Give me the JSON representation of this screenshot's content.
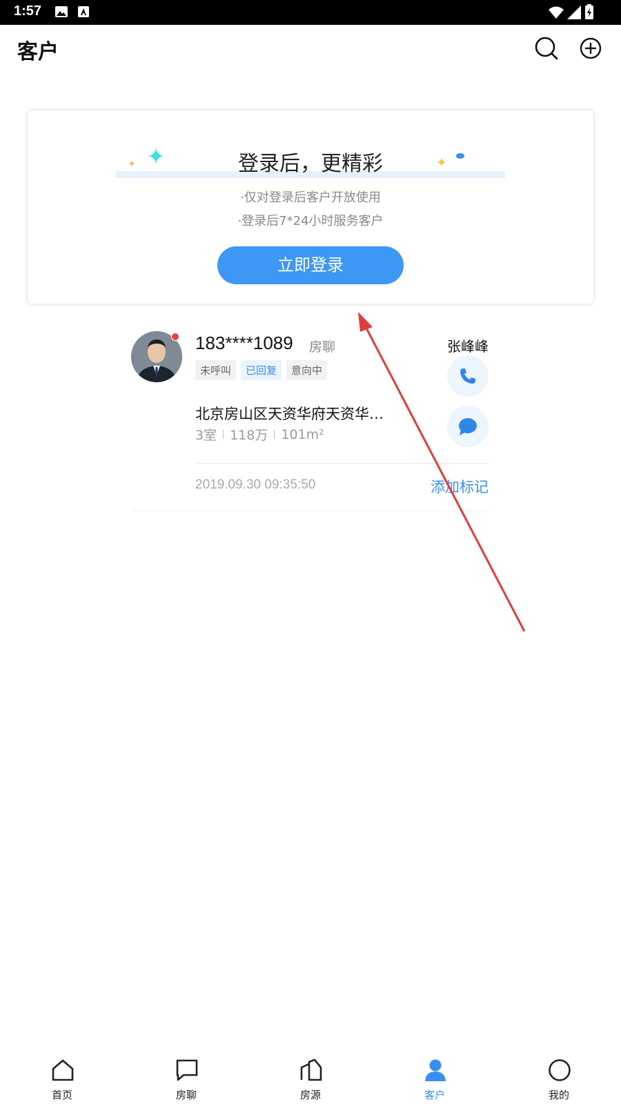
{
  "status_bar": {
    "time": "1:57"
  },
  "header": {
    "title": "客户"
  },
  "login_card": {
    "title": "登录后，更精彩",
    "notes": [
      "·仅对登录后客户开放使用",
      "·登录后7*24小时服务客户"
    ],
    "button_label": "立即登录"
  },
  "customer": {
    "phone": "183****1089",
    "source": "房聊",
    "agent_name": "张峰峰",
    "tags": [
      "未呼叫",
      "已回复",
      "意向中"
    ],
    "address": "北京房山区天资华府天资华…",
    "specs": {
      "rooms": "3室",
      "price": "118万",
      "area": "101m²"
    },
    "datetime": "2019.09.30 09:35:50",
    "add_mark_label": "添加标记"
  },
  "tabbar": {
    "tabs": [
      {
        "label": "首页",
        "icon": "home-icon"
      },
      {
        "label": "房聊",
        "icon": "chat-icon"
      },
      {
        "label": "房源",
        "icon": "building-icon"
      },
      {
        "label": "客户",
        "icon": "user-icon",
        "active": true
      },
      {
        "label": "我的",
        "icon": "profile-circle-icon"
      }
    ]
  },
  "colors": {
    "accent": "#3d97f5",
    "unread": "#f23c3c",
    "annotation_arrow": "#e03c3c"
  }
}
